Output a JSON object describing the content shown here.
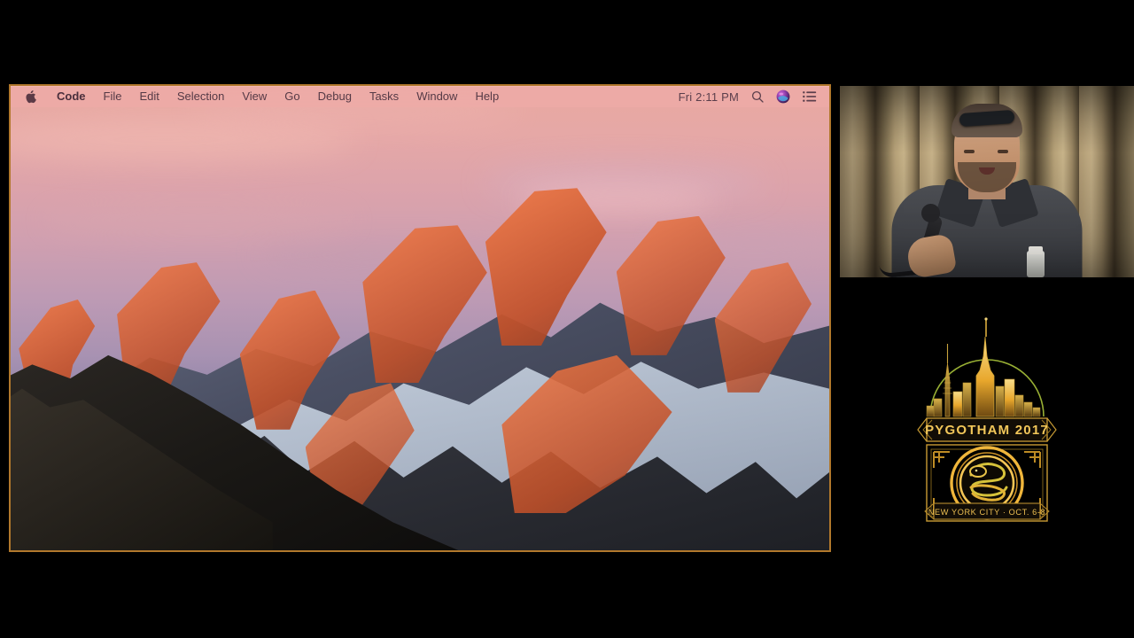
{
  "menubar": {
    "apple_icon": "apple-logo-icon",
    "items": [
      {
        "label": "Code",
        "active": true
      },
      {
        "label": "File",
        "active": false
      },
      {
        "label": "Edit",
        "active": false
      },
      {
        "label": "Selection",
        "active": false
      },
      {
        "label": "View",
        "active": false
      },
      {
        "label": "Go",
        "active": false
      },
      {
        "label": "Debug",
        "active": false
      },
      {
        "label": "Tasks",
        "active": false
      },
      {
        "label": "Window",
        "active": false
      },
      {
        "label": "Help",
        "active": false
      }
    ],
    "clock": "Fri 2:11 PM",
    "status_icons": [
      {
        "name": "spotlight-search-icon"
      },
      {
        "name": "siri-icon"
      },
      {
        "name": "notification-center-icon"
      }
    ],
    "bar_color": "#eeaaa8",
    "text_color": "#553a46"
  },
  "screen_share": {
    "wallpaper_name": "macos-sierra-mountain-wallpaper",
    "border_color": "#b1782c"
  },
  "webcam": {
    "scene": "conference-speaker-with-microphone",
    "curtain_color": "#b29a6e"
  },
  "logo": {
    "title": "PYGOTHAM 2017",
    "subtitle": "NEW YORK CITY · OCT. 6-8",
    "gold": "#e5a82e",
    "gold_light": "#f6d26a",
    "gold_dark": "#8a5f18",
    "green": "#a8c23a"
  }
}
